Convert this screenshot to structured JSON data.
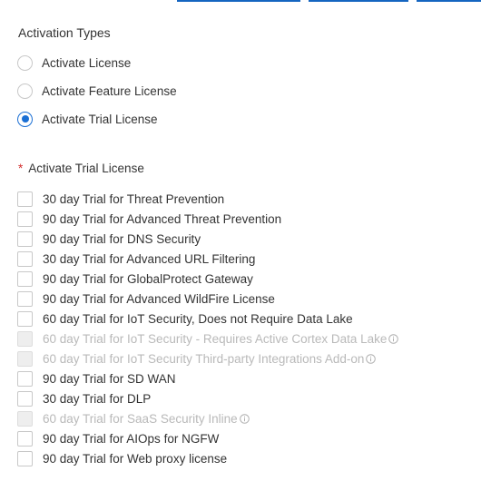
{
  "colors": {
    "accent": "#1a6fd4",
    "required": "#d32f2f",
    "disabled_text": "#b9b9b9"
  },
  "activation_types": {
    "title": "Activation Types",
    "selected": "Activate Trial License",
    "options": [
      {
        "label": "Activate License",
        "selected": false
      },
      {
        "label": "Activate Feature License",
        "selected": false
      },
      {
        "label": "Activate Trial License",
        "selected": true
      }
    ]
  },
  "trial_licenses": {
    "required_marker": "*",
    "title": "Activate Trial License",
    "items": [
      {
        "label": "30 day Trial for Threat Prevention",
        "checked": false,
        "disabled": false
      },
      {
        "label": "90 day Trial for Advanced Threat Prevention",
        "checked": false,
        "disabled": false
      },
      {
        "label": "90 day Trial for DNS Security",
        "checked": false,
        "disabled": false
      },
      {
        "label": "30 day Trial for Advanced URL Filtering",
        "checked": false,
        "disabled": false
      },
      {
        "label": "90 day Trial for GlobalProtect Gateway",
        "checked": false,
        "disabled": false
      },
      {
        "label": "90 day Trial for Advanced WildFire License",
        "checked": false,
        "disabled": false
      },
      {
        "label": "60 day Trial for IoT Security, Does not Require Data Lake",
        "checked": false,
        "disabled": false
      },
      {
        "label": "60 day Trial for IoT Security - Requires Active Cortex Data Lake",
        "checked": false,
        "disabled": true,
        "info_icon": "info-icon"
      },
      {
        "label": "60 day Trial for IoT Security Third-party Integrations Add-on",
        "checked": false,
        "disabled": true,
        "info_icon": "info-icon"
      },
      {
        "label": "90 day Trial for SD WAN",
        "checked": false,
        "disabled": false
      },
      {
        "label": "30 day Trial for DLP",
        "checked": false,
        "disabled": false
      },
      {
        "label": "60 day Trial for SaaS Security Inline",
        "checked": false,
        "disabled": true,
        "info_icon": "info-icon"
      },
      {
        "label": "90 day Trial for AIOps for NGFW",
        "checked": false,
        "disabled": false
      },
      {
        "label": "90 day Trial for Web proxy license",
        "checked": false,
        "disabled": false
      }
    ]
  }
}
